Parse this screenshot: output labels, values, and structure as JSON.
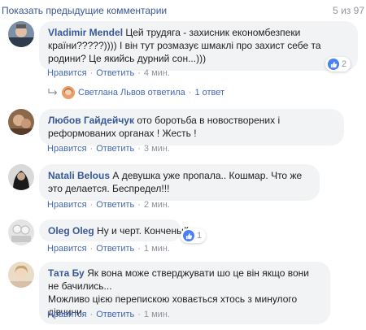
{
  "header": {
    "prev_comments": "Показать предыдущие комментарии",
    "counter": "5 из 97"
  },
  "comments": [
    {
      "author": "Vladimir Mendel",
      "text": "Цей трудяга - захисник економбезпеки країни?????)))) І він тут розмазує шмаклі про захист себе та родини? Це якийсь дурний сон...)))",
      "like_label": "Нравится",
      "reply_label": "Ответить",
      "time": "4 мин.",
      "reactions": "2",
      "reply_summary": {
        "name_action": "Светлана Львов ответила",
        "count": "1 ответ"
      }
    },
    {
      "author": "Любов Гайдейчук",
      "text": "ото боротьба в новостворених і реформованих органах ! Жесть !",
      "like_label": "Нравится",
      "reply_label": "Ответить",
      "time": "3 мин."
    },
    {
      "author": "Natali Belous",
      "text": "А девушка уже пропала.. Кошмар. Что же это делается. Беспредел!!!",
      "like_label": "Нравится",
      "reply_label": "Ответить",
      "time": "2 мин."
    },
    {
      "author": "Oleg Oleg",
      "text": "Ну и черт. Конченый",
      "like_label": "Нравится",
      "reply_label": "Ответить",
      "time": "1 мин.",
      "reactions": "1"
    },
    {
      "author": "Тата Бу",
      "text_line1": "Як вона може стверджувати шо це він якщо вони не бачились...",
      "text_line2": "Можливо цією перепискою ховається хтось з минулого дівчини.",
      "like_label": "Нравится",
      "reply_label": "Ответить",
      "time": "1 мин."
    }
  ],
  "colors": {
    "link": "#385898",
    "action": "#4267b2",
    "meta": "#90949c",
    "bubble": "#f2f3f5",
    "like": "#4a80f5"
  }
}
